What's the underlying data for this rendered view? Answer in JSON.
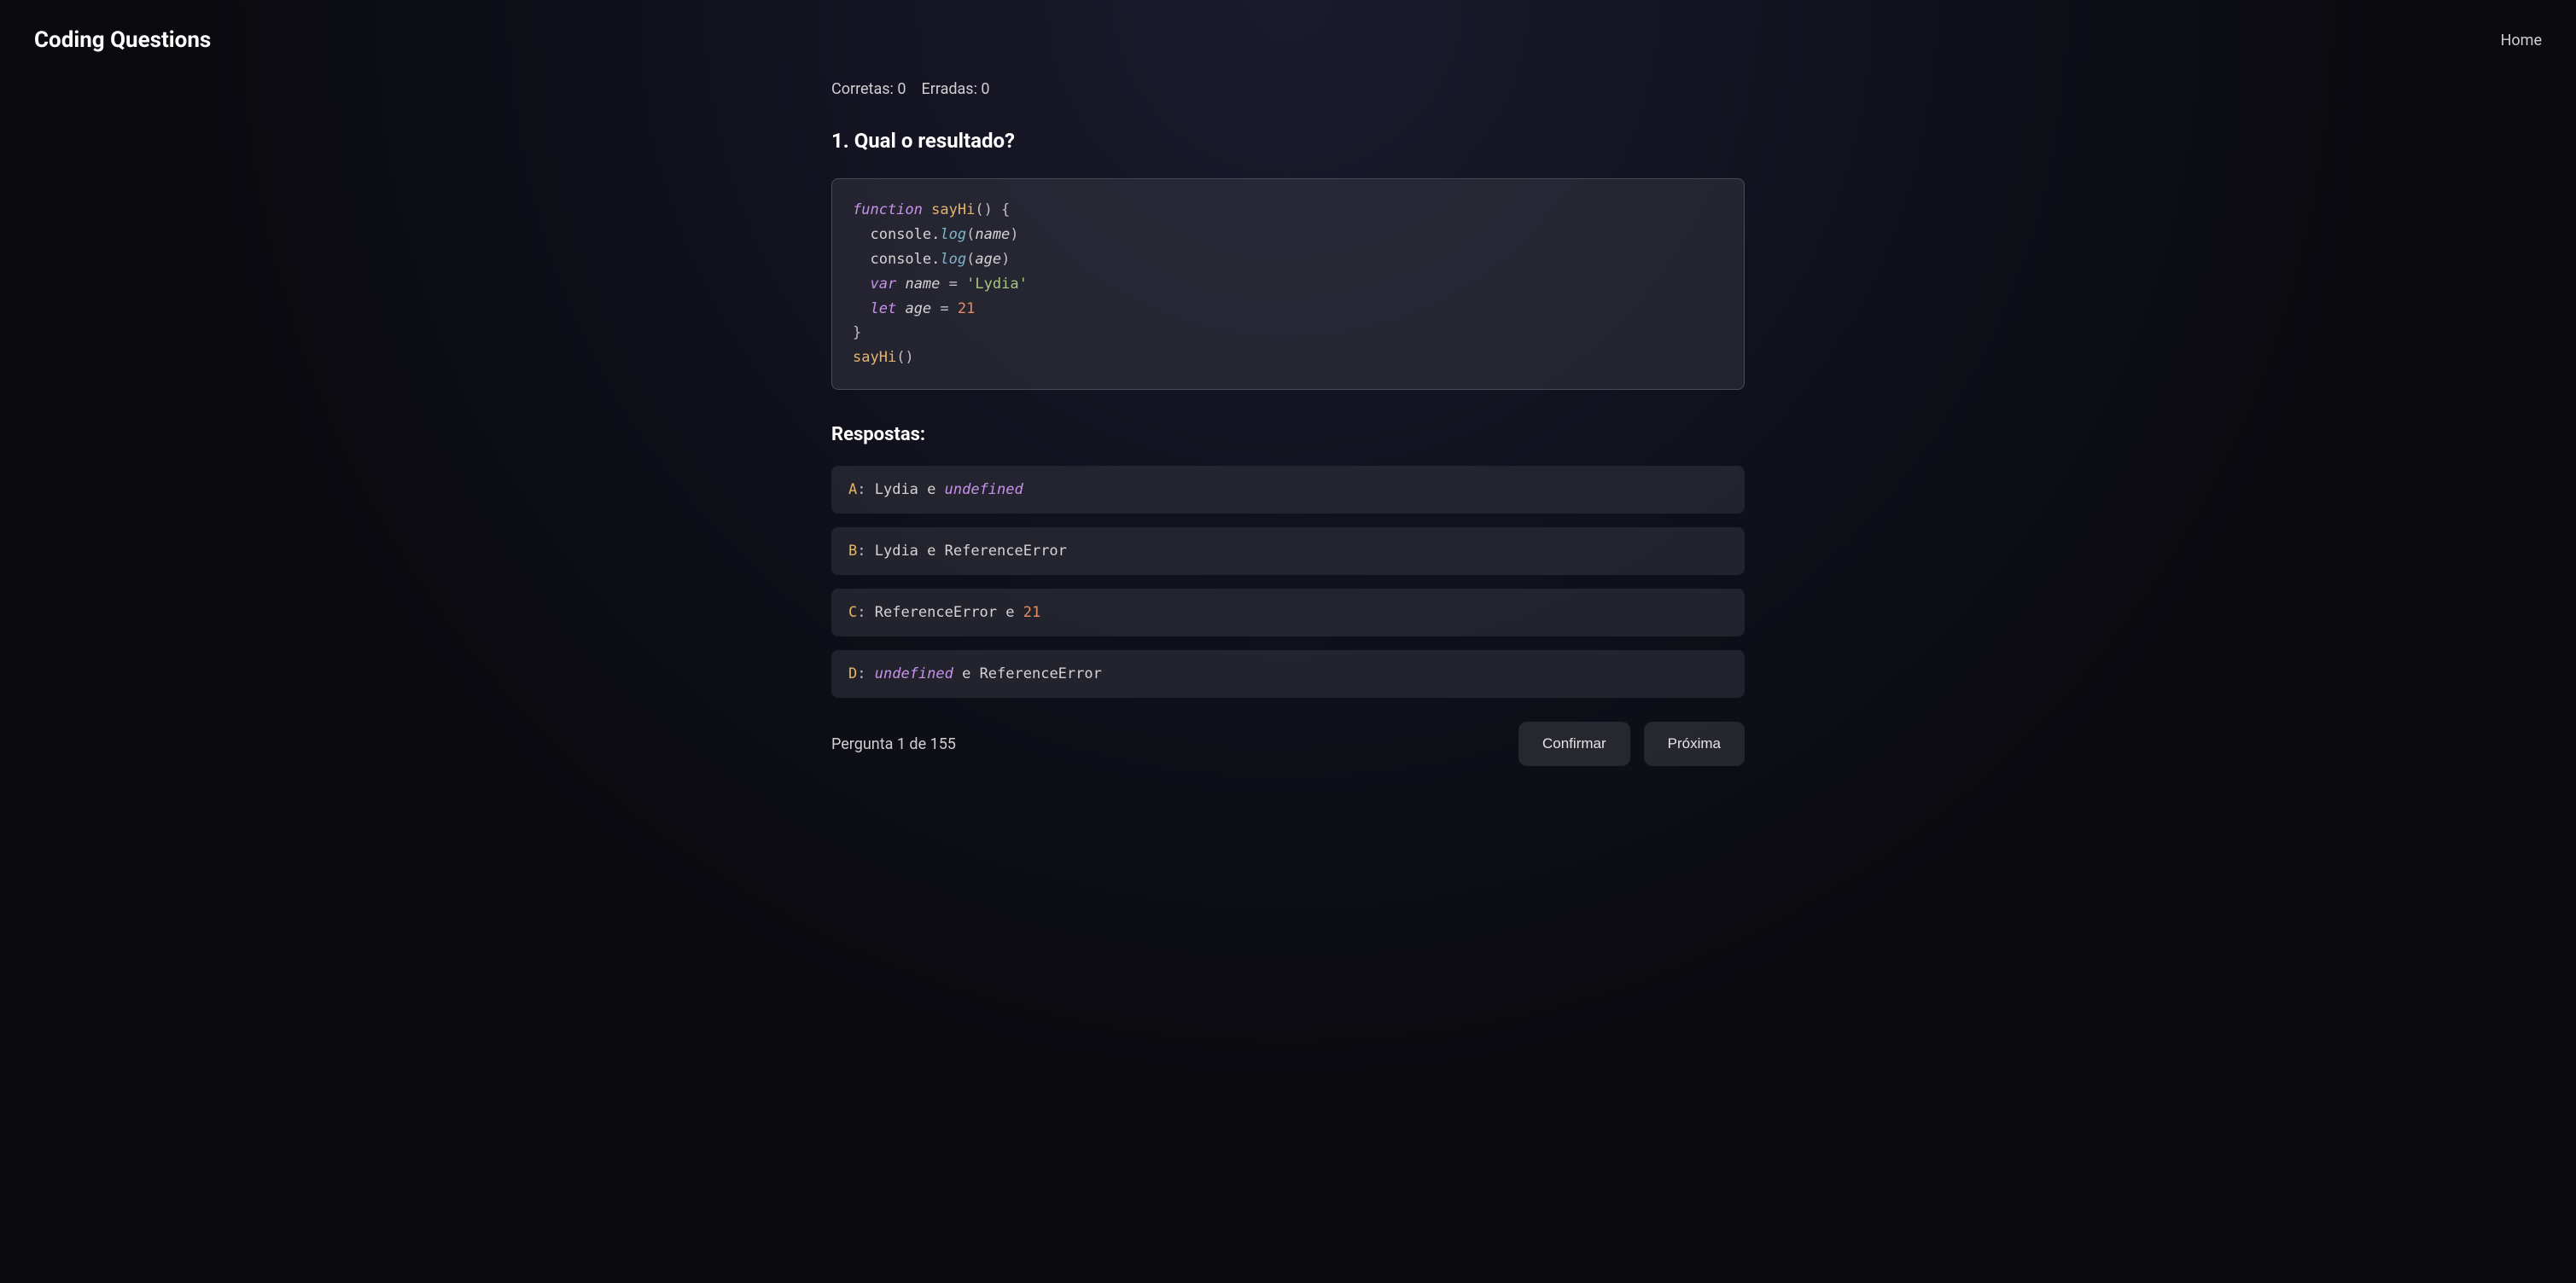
{
  "header": {
    "brand": "Coding Questions",
    "home": "Home"
  },
  "score": {
    "correct_label": "Corretas:",
    "correct_value": "0",
    "incorrect_label": "Erradas:",
    "incorrect_value": "0"
  },
  "question": {
    "title": "1. Qual o resultado?",
    "code": {
      "line1_keyword": "function",
      "line1_func": "sayHi",
      "line1_rest": "() {",
      "line2_console": "console.",
      "line2_log": "log",
      "line2_open": "(",
      "line2_arg": "name",
      "line2_close": ")",
      "line3_console": "console.",
      "line3_log": "log",
      "line3_open": "(",
      "line3_arg": "age",
      "line3_close": ")",
      "line4_var": "var",
      "line4_name": "name",
      "line4_eq": "=",
      "line4_str": "'Lydia'",
      "line5_let": "let",
      "line5_name": "age",
      "line5_eq": "=",
      "line5_num": "21",
      "line6": "}",
      "line7_func": "sayHi",
      "line7_call": "()"
    }
  },
  "answers": {
    "heading": "Respostas:",
    "options": [
      {
        "letter": "A",
        "pre": "Lydia e ",
        "undef": "undefined",
        "post": ""
      },
      {
        "letter": "B",
        "pre": "Lydia e ReferenceError",
        "undef": "",
        "post": ""
      },
      {
        "letter": "C",
        "pre": "ReferenceError e ",
        "num": "21",
        "post": ""
      },
      {
        "letter": "D",
        "pre": "",
        "undef": "undefined",
        "post": " e ReferenceError"
      }
    ]
  },
  "footer": {
    "pagination": "Pergunta 1 de 155",
    "confirm": "Confirmar",
    "next": "Próxima"
  }
}
